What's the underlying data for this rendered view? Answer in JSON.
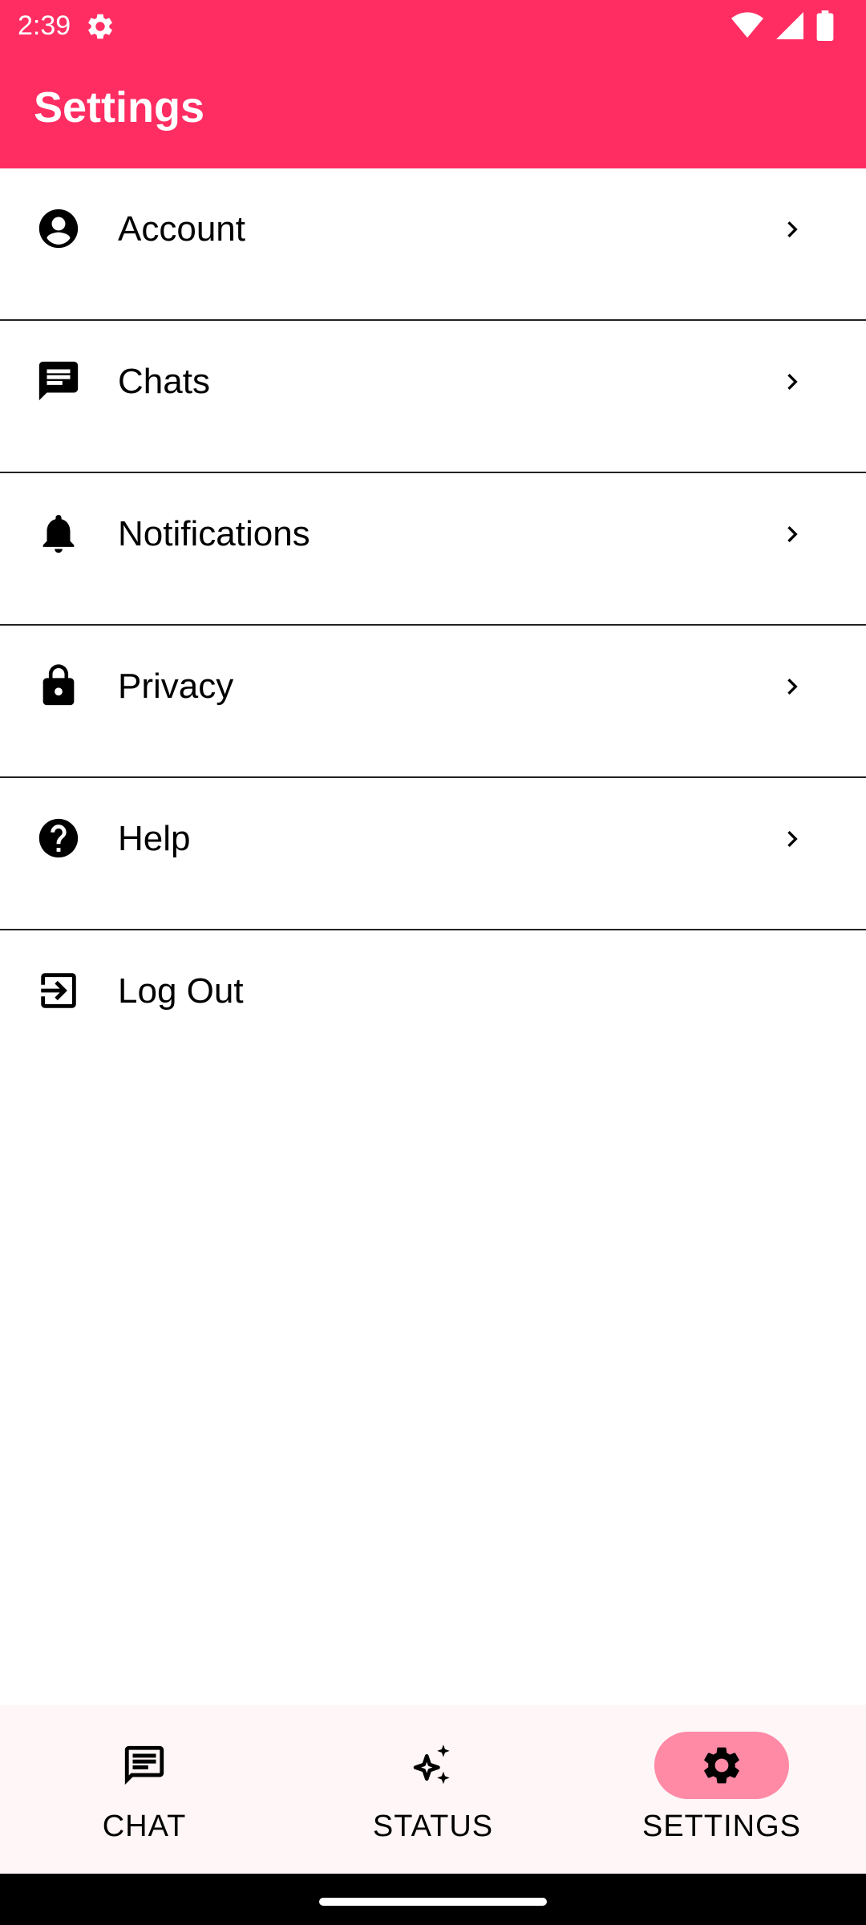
{
  "status_bar": {
    "time": "2:39",
    "icons": [
      "gear-icon",
      "wifi-icon",
      "signal-icon",
      "battery-icon"
    ]
  },
  "header": {
    "title": "Settings",
    "background_color": "#ff2d62"
  },
  "settings_list": {
    "items": [
      {
        "label": "Account",
        "icon": "account-circle-icon",
        "has_chevron": true
      },
      {
        "label": "Chats",
        "icon": "chat-icon",
        "has_chevron": true
      },
      {
        "label": "Notifications",
        "icon": "bell-icon",
        "has_chevron": true
      },
      {
        "label": "Privacy",
        "icon": "lock-icon",
        "has_chevron": true
      },
      {
        "label": "Help",
        "icon": "help-icon",
        "has_chevron": true
      },
      {
        "label": "Log Out",
        "icon": "logout-icon",
        "has_chevron": false
      }
    ]
  },
  "bottom_nav": {
    "items": [
      {
        "label": "CHAT",
        "icon": "chat-icon",
        "active": false
      },
      {
        "label": "STATUS",
        "icon": "sparkle-icon",
        "active": false
      },
      {
        "label": "SETTINGS",
        "icon": "gear-icon",
        "active": true
      }
    ],
    "active_pill_color": "#ff8aa6"
  }
}
